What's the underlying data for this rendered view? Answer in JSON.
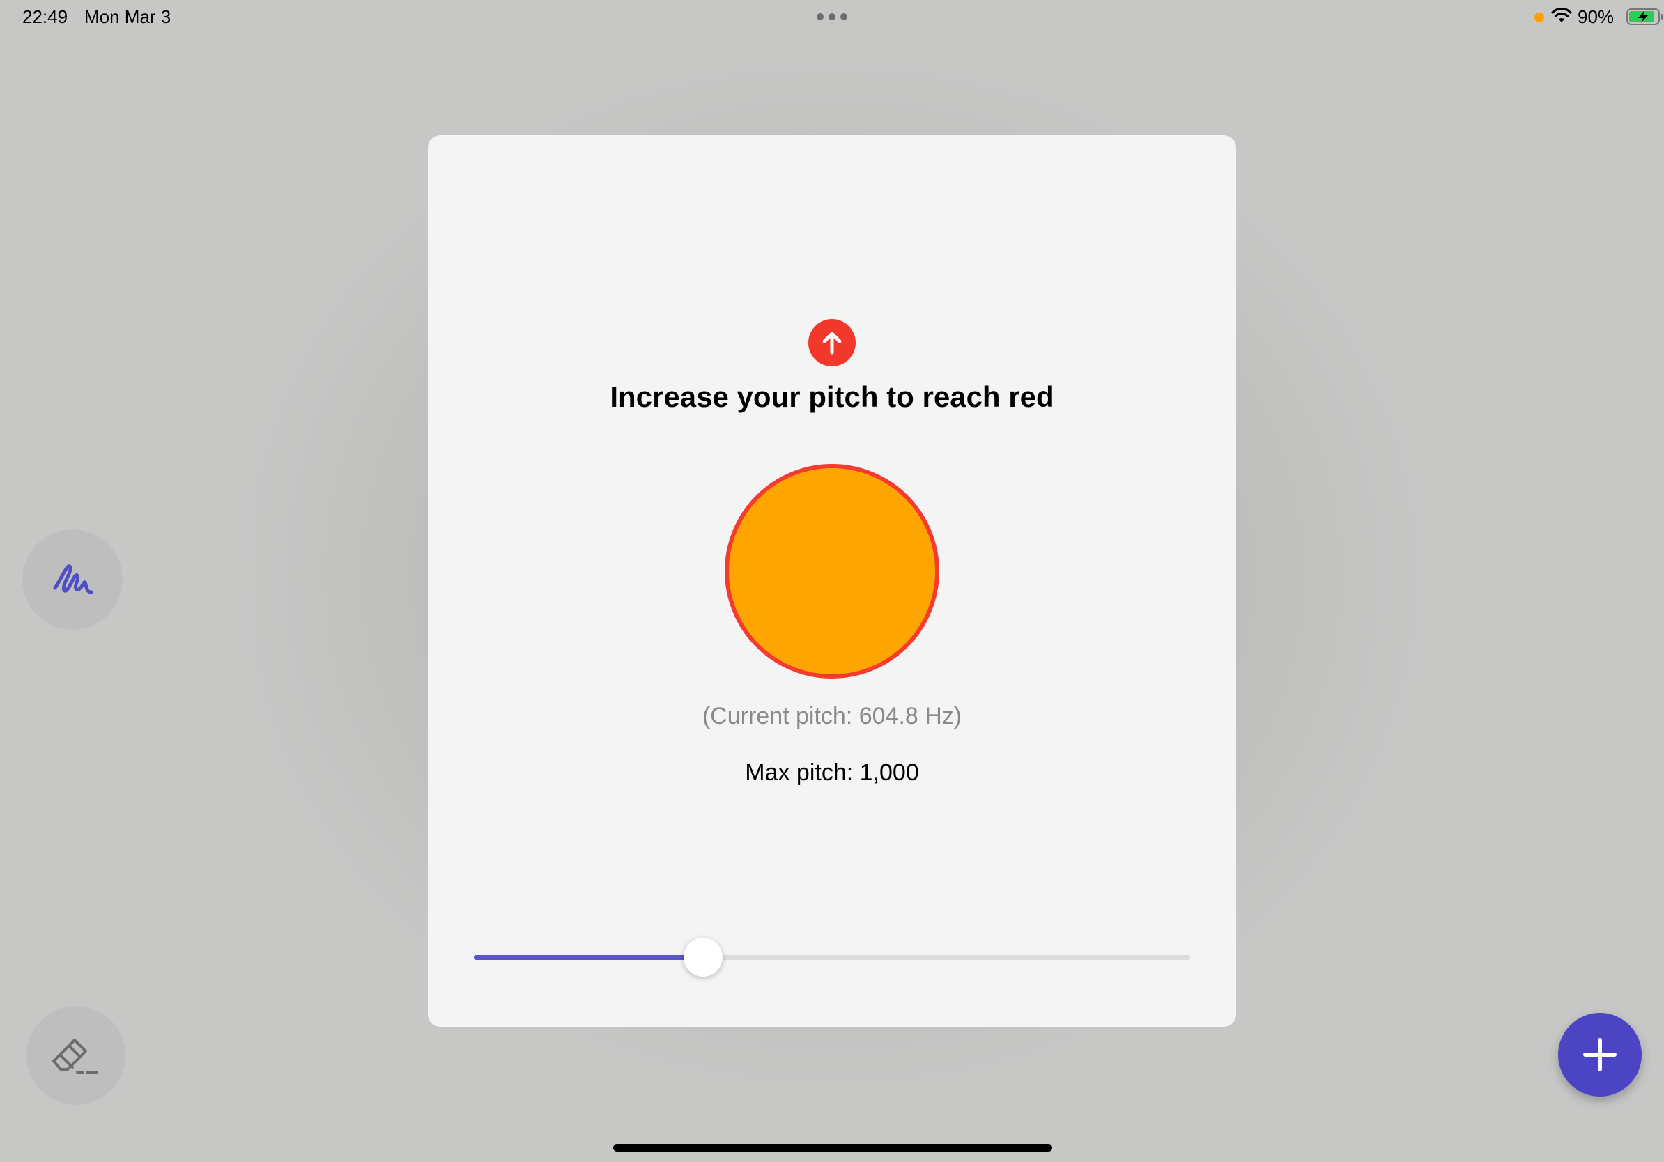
{
  "status_bar": {
    "time": "22:49",
    "date": "Mon Mar 3",
    "battery_percent": "90%",
    "battery_level": 0.9,
    "battery_charging": true,
    "privacy_dot_color": "#ff9f0a"
  },
  "tools": {
    "pen_color": "#4f4fc4",
    "eraser_color": "#6d6d6d",
    "add_button_color": "#4b44c3"
  },
  "modal": {
    "title": "Increase your pitch to reach red",
    "direction_icon": "arrow-up-icon",
    "direction_badge_color": "#f2382b",
    "circle_fill": "#ffa500",
    "circle_border": "#f53b30",
    "current_pitch_text": "(Current pitch: 604.8 Hz)",
    "max_pitch_text": "Max pitch: 1,000",
    "slider_fraction": 0.32,
    "slider_fill_color": "#5b55cc"
  }
}
